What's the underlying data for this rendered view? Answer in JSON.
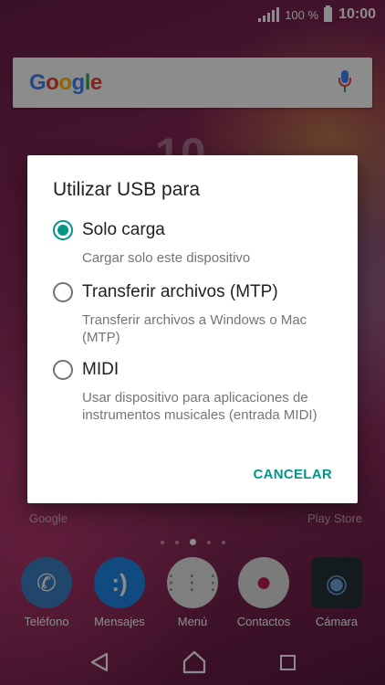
{
  "status_bar": {
    "battery_percent": "100 %",
    "time": "10:00"
  },
  "google_widget": {
    "logo_letters": [
      "G",
      "o",
      "o",
      "g",
      "l",
      "e"
    ]
  },
  "home_screen": {
    "backdrop_clock": "10",
    "shortcut_labels": {
      "left": "Google",
      "right": "Play Store"
    },
    "dock": [
      {
        "label": "Teléfono",
        "icon": "phone-icon",
        "color": "#3b82c4"
      },
      {
        "label": "Mensajes",
        "icon": "messages-icon",
        "color": "#1e88e5"
      },
      {
        "label": "Menú",
        "icon": "app-drawer-icon",
        "color": "#e8e8e8"
      },
      {
        "label": "Contactos",
        "icon": "contacts-icon",
        "color": "#e0e0e0"
      },
      {
        "label": "Cámara",
        "icon": "camera-icon",
        "color": "#263238"
      }
    ]
  },
  "dialog": {
    "title": "Utilizar USB para",
    "options": [
      {
        "title": "Solo carga",
        "description": "Cargar solo este dispositivo",
        "selected": true
      },
      {
        "title": "Transferir archivos (MTP)",
        "description": "Transferir archivos a Windows o Mac (MTP)",
        "selected": false
      },
      {
        "title": "MIDI",
        "description": "Usar dispositivo para aplicaciones de instrumentos musicales (entrada MIDI)",
        "selected": false
      }
    ],
    "cancel_label": "CANCELAR",
    "accent_color": "#009688"
  }
}
